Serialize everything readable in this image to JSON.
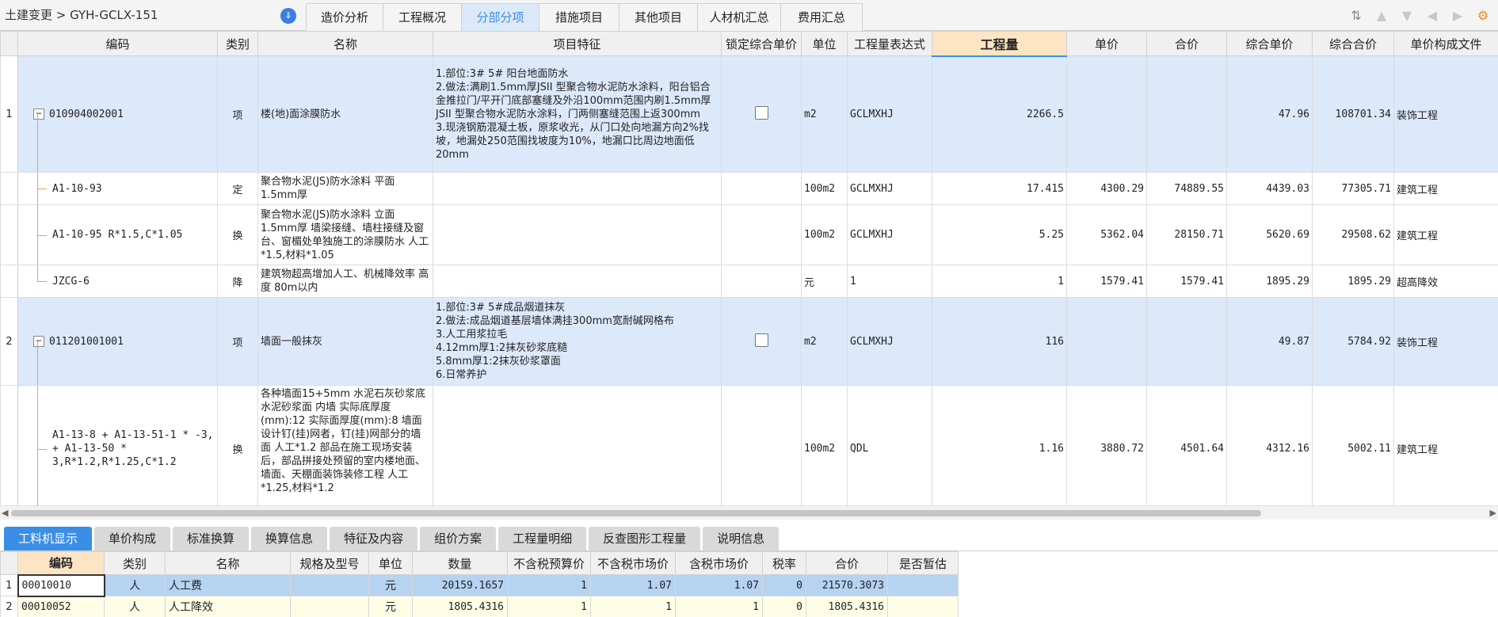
{
  "topbar": {
    "breadcrumb": "土建变更 > GYH-GCLX-151",
    "collapse_icon": "chevron-down-double-icon",
    "tabs": [
      {
        "label": "造价分析",
        "active": false
      },
      {
        "label": "工程概况",
        "active": false
      },
      {
        "label": "分部分项",
        "active": true
      },
      {
        "label": "措施项目",
        "active": false
      },
      {
        "label": "其他项目",
        "active": false
      },
      {
        "label": "人材机汇总",
        "active": false
      },
      {
        "label": "费用汇总",
        "active": false
      }
    ],
    "accent_color": "#3a8ee6"
  },
  "main_table": {
    "columns": [
      "编码",
      "类别",
      "名称",
      "项目特征",
      "锁定综合单价",
      "单位",
      "工程量表达式",
      "工程量",
      "单价",
      "合价",
      "综合单价",
      "综合合价",
      "单价构成文件"
    ],
    "rows": [
      {
        "num": "1",
        "code": "010904002001",
        "type": "项",
        "name": "楼(地)面涂膜防水",
        "feature": "1.部位:3# 5# 阳台地面防水\n2.做法:满刷1.5mm厚JSII 型聚合物水泥防水涂料，阳台铝合金推拉门/平开门底部塞缝及外沿100mm范围内刷1.5mm厚JSII 型聚合物水泥防水涂料，门两侧塞缝范围上返300mm\n3.现浇钢筋混凝土板，原浆收光，从门口处向地漏方向2%找坡，地漏处250范围找坡度为10%，地漏口比周边地面低20mm",
        "lock": true,
        "unit": "m2",
        "expr": "GCLMXHJ",
        "qty": "2266.5",
        "price": "",
        "total": "",
        "comp_price": "47.96",
        "comp_total": "108701.34",
        "file": "装饰工程"
      },
      {
        "num": "",
        "code": "A1-10-93",
        "type": "定",
        "name": "聚合物水泥(JS)防水涂料 平面 1.5mm厚",
        "feature": "",
        "lock": false,
        "unit": "100m2",
        "expr": "GCLMXHJ",
        "qty": "17.415",
        "price": "4300.29",
        "total": "74889.55",
        "comp_price": "4439.03",
        "comp_total": "77305.71",
        "file": "建筑工程"
      },
      {
        "num": "",
        "code": "A1-10-95 R*1.5,C*1.05",
        "type": "换",
        "name": "聚合物水泥(JS)防水涂料 立面 1.5mm厚  墙梁接缝、墙柱接缝及窗台、窗楣处单独施工的涂膜防水 人工*1.5,材料*1.05",
        "feature": "",
        "lock": false,
        "unit": "100m2",
        "expr": "GCLMXHJ",
        "qty": "5.25",
        "price": "5362.04",
        "total": "28150.71",
        "comp_price": "5620.69",
        "comp_total": "29508.62",
        "file": "建筑工程"
      },
      {
        "num": "",
        "code": "JZCG-6",
        "type": "降",
        "name": "建筑物超高增加人工、机械降效率 高度 80m以内",
        "feature": "",
        "lock": false,
        "unit": "元",
        "expr": "1",
        "qty": "1",
        "price": "1579.41",
        "total": "1579.41",
        "comp_price": "1895.29",
        "comp_total": "1895.29",
        "file": "超高降效"
      },
      {
        "num": "2",
        "code": "011201001001",
        "type": "项",
        "name": "墙面一般抹灰",
        "feature": "1.部位:3# 5#成品烟道抹灰\n2.做法:成品烟道基层墙体满挂300mm宽耐碱网格布\n3.人工用浆拉毛\n4.12mm厚1:2抹灰砂浆底糙\n5.8mm厚1:2抹灰砂浆罩面\n6.日常养护",
        "lock": true,
        "unit": "m2",
        "expr": "GCLMXHJ",
        "qty": "116",
        "price": "",
        "total": "",
        "comp_price": "49.87",
        "comp_total": "5784.92",
        "file": "装饰工程"
      },
      {
        "num": "",
        "code": "A1-13-8 + A1-13-51-1 * -3, + A1-13-50 * 3,R*1.2,R*1.25,C*1.2",
        "type": "换",
        "name": "各种墙面15+5mm 水泥石灰砂浆底 水泥砂浆面 内墙  实际底厚度(mm):12  实际面厚度(mm):8  墙面设计钉(挂)网者，钉(挂)网部分的墙面 人工*1.2  部品在施工现场安装后，部品拼接处预留的室内楼地面、墙面、天棚面装饰装修工程 人工*1.25,材料*1.2",
        "feature": "",
        "lock": false,
        "unit": "100m2",
        "expr": "QDL",
        "qty": "1.16",
        "price": "3880.72",
        "total": "4501.64",
        "comp_price": "4312.16",
        "comp_total": "5002.11",
        "file": "建筑工程"
      }
    ]
  },
  "bottom_tabs": [
    {
      "label": "工料机显示",
      "active": true
    },
    {
      "label": "单价构成",
      "active": false
    },
    {
      "label": "标准换算",
      "active": false
    },
    {
      "label": "换算信息",
      "active": false
    },
    {
      "label": "特征及内容",
      "active": false
    },
    {
      "label": "组价方案",
      "active": false
    },
    {
      "label": "工程量明细",
      "active": false
    },
    {
      "label": "反查图形工程量",
      "active": false
    },
    {
      "label": "说明信息",
      "active": false
    }
  ],
  "bottom_table": {
    "columns": [
      "编码",
      "类别",
      "名称",
      "规格及型号",
      "单位",
      "数量",
      "不含税预算价",
      "不含税市场价",
      "含税市场价",
      "税率",
      "合价",
      "是否暂估"
    ],
    "rows": [
      {
        "num": "1",
        "code": "00010010",
        "type": "人",
        "name": "人工费",
        "spec": "",
        "unit": "元",
        "qty": "20159.1657",
        "pre_budget": "1",
        "pre_market": "1.07",
        "tax_market": "1.07",
        "rate": "0",
        "total": "21570.3073",
        "est": ""
      },
      {
        "num": "2",
        "code": "00010052",
        "type": "人",
        "name": "人工降效",
        "spec": "",
        "unit": "元",
        "qty": "1805.4316",
        "pre_budget": "1",
        "pre_market": "1",
        "tax_market": "1",
        "rate": "0",
        "total": "1805.4316",
        "est": ""
      }
    ]
  }
}
